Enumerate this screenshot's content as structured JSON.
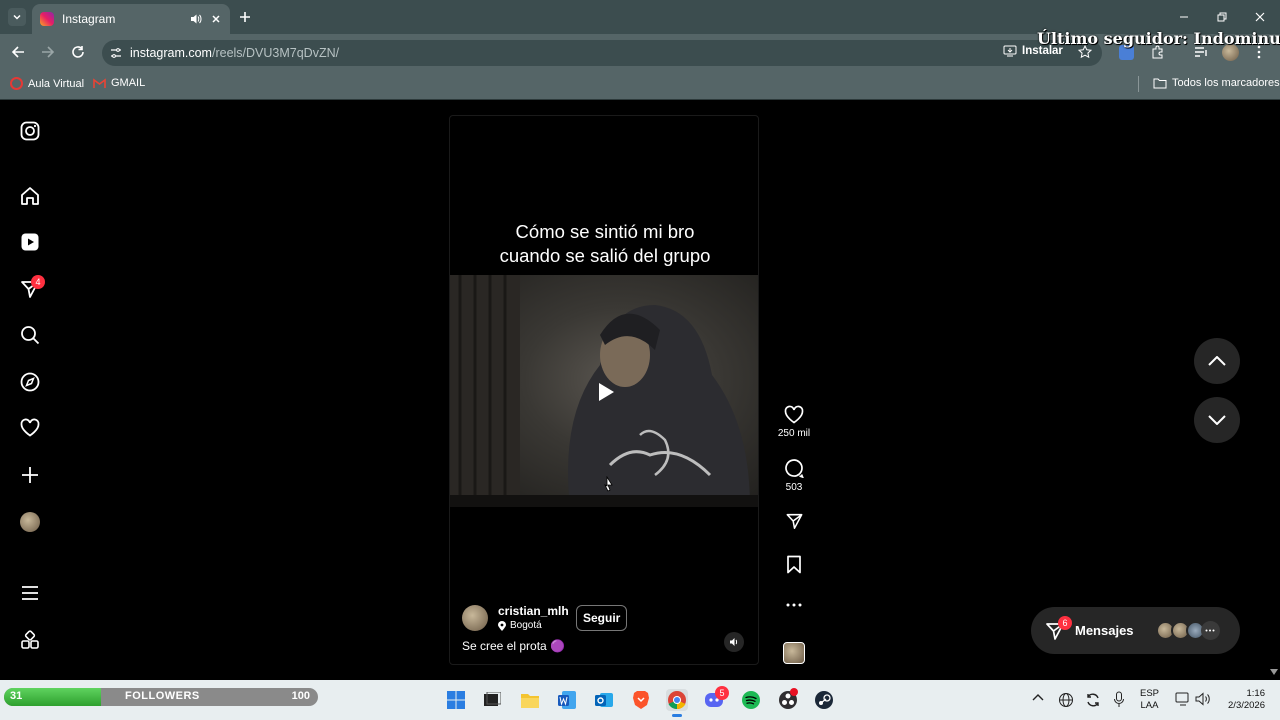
{
  "browser": {
    "tab_title": "Instagram",
    "url_host": "instagram.com",
    "url_path": "/reels/DVU3M7qDvZN/",
    "install_label": "Instalar",
    "bookmarks": [
      "Aula Virtual",
      "GMAIL"
    ],
    "all_bookmarks_label": "Todos los marcadores"
  },
  "stream_overlay": {
    "last_follower": "Último seguidor: Indominus_Z"
  },
  "sidebar": {
    "notifications_badge": "4"
  },
  "reel": {
    "caption_line1": "Cómo se sintió mi bro",
    "caption_line2": "cuando se salió del grupo",
    "username": "cristian_mlh",
    "location": "Bogotá",
    "follow_label": "Seguir",
    "description": "Se cree el prota 🟣"
  },
  "actions": {
    "likes": "250 mil",
    "comments": "503"
  },
  "messages": {
    "label": "Mensajes",
    "badge": "6"
  },
  "followers_widget": {
    "current": "31",
    "label": "FOLLOWERS",
    "goal": "100",
    "progress": 0.31
  },
  "taskbar": {
    "discord_badge": "5",
    "lang_line1": "ESP",
    "lang_line2": "LAA",
    "time": "1:16",
    "date": "2/3/2026"
  },
  "colors": {
    "chrome_frame": "#3c4d4f",
    "chrome_toolbar": "#556567",
    "instagram_bg": "#000000",
    "badge_red": "#ff3040",
    "followers_green": "#2ea02e"
  }
}
